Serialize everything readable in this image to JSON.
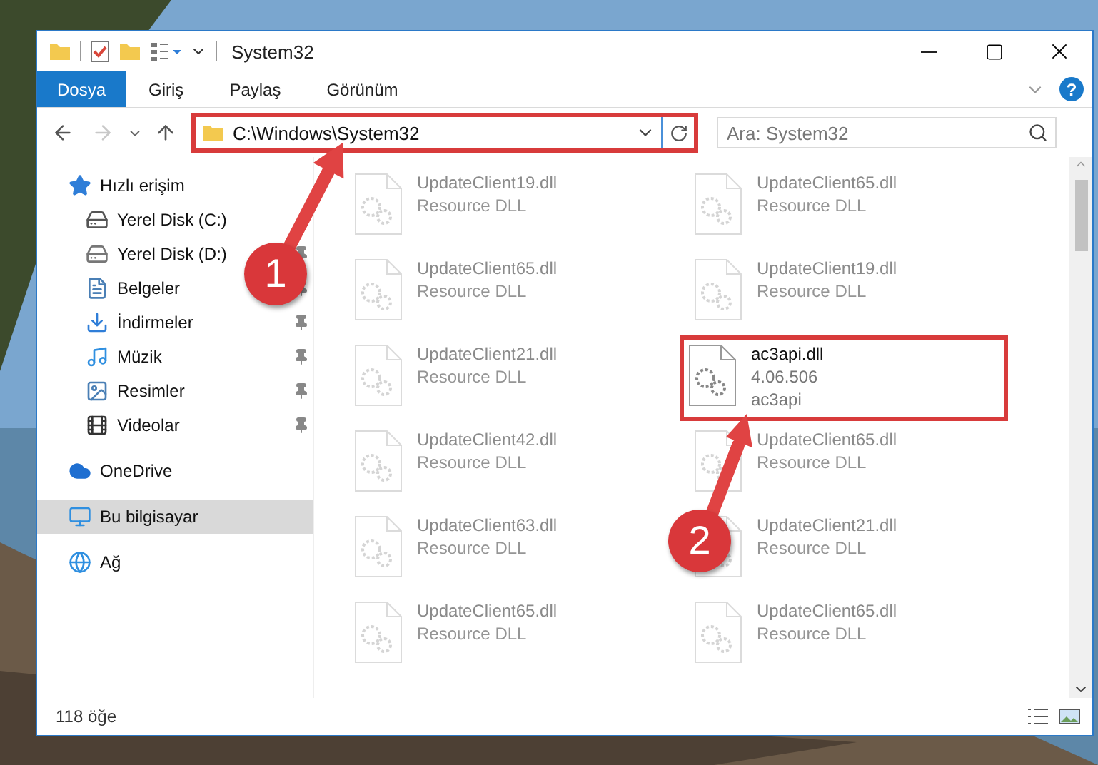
{
  "window": {
    "title": "System32"
  },
  "ribbon": {
    "tabs": [
      {
        "label": "Dosya",
        "kind": "file"
      },
      {
        "label": "Giriş",
        "kind": "tab"
      },
      {
        "label": "Paylaş",
        "kind": "tab"
      },
      {
        "label": "Görünüm",
        "kind": "tab"
      }
    ],
    "help": "?"
  },
  "navigation": {
    "forward_disabled": true
  },
  "address": {
    "path": "C:\\Windows\\System32",
    "highlighted": true
  },
  "search": {
    "placeholder": "Ara: System32"
  },
  "sidebar": {
    "items": [
      {
        "label": "Hızlı erişim",
        "kind": "star",
        "selected": false,
        "children": [
          {
            "label": "Yerel Disk (C:)",
            "kind": "drive-windows",
            "pinned": false
          },
          {
            "label": "Yerel Disk (D:)",
            "kind": "drive",
            "pinned": true
          },
          {
            "label": "Belgeler",
            "kind": "documents",
            "pinned": true
          },
          {
            "label": "İndirmeler",
            "kind": "download",
            "pinned": true
          },
          {
            "label": "Müzik",
            "kind": "music",
            "pinned": true
          },
          {
            "label": "Resimler",
            "kind": "pictures",
            "pinned": true
          },
          {
            "label": "Videolar",
            "kind": "videos",
            "pinned": true
          }
        ]
      },
      {
        "label": "OneDrive",
        "kind": "cloud",
        "selected": false
      },
      {
        "label": "Bu bilgisayar",
        "kind": "computer",
        "selected": true
      },
      {
        "label": "Ağ",
        "kind": "network",
        "selected": false
      }
    ]
  },
  "files": [
    {
      "name": "UpdateClient19.dll",
      "lines": [
        "Resource DLL"
      ],
      "faded": true,
      "highlighted": false
    },
    {
      "name": "UpdateClient65.dll",
      "lines": [
        "Resource DLL"
      ],
      "faded": true,
      "highlighted": false
    },
    {
      "name": "UpdateClient65.dll",
      "lines": [
        "Resource DLL"
      ],
      "faded": true,
      "highlighted": false
    },
    {
      "name": "UpdateClient19.dll",
      "lines": [
        "Resource DLL"
      ],
      "faded": true,
      "highlighted": false
    },
    {
      "name": "UpdateClient21.dll",
      "lines": [
        "Resource DLL"
      ],
      "faded": true,
      "highlighted": false
    },
    {
      "name": "ac3api.dll",
      "lines": [
        "4.06.506",
        "ac3api"
      ],
      "faded": false,
      "highlighted": true
    },
    {
      "name": "UpdateClient42.dll",
      "lines": [
        "Resource DLL"
      ],
      "faded": true,
      "highlighted": false
    },
    {
      "name": "UpdateClient65.dll",
      "lines": [
        "Resource DLL"
      ],
      "faded": true,
      "highlighted": false
    },
    {
      "name": "UpdateClient63.dll",
      "lines": [
        "Resource DLL"
      ],
      "faded": true,
      "highlighted": false
    },
    {
      "name": "UpdateClient21.dll",
      "lines": [
        "Resource DLL"
      ],
      "faded": true,
      "highlighted": false
    },
    {
      "name": "UpdateClient65.dll",
      "lines": [
        "Resource DLL"
      ],
      "faded": true,
      "highlighted": false
    },
    {
      "name": "UpdateClient65.dll",
      "lines": [
        "Resource DLL"
      ],
      "faded": true,
      "highlighted": false
    }
  ],
  "status_bar": {
    "count": "118 öğe"
  },
  "annotations": [
    {
      "number": "1"
    },
    {
      "number": "2"
    }
  ]
}
